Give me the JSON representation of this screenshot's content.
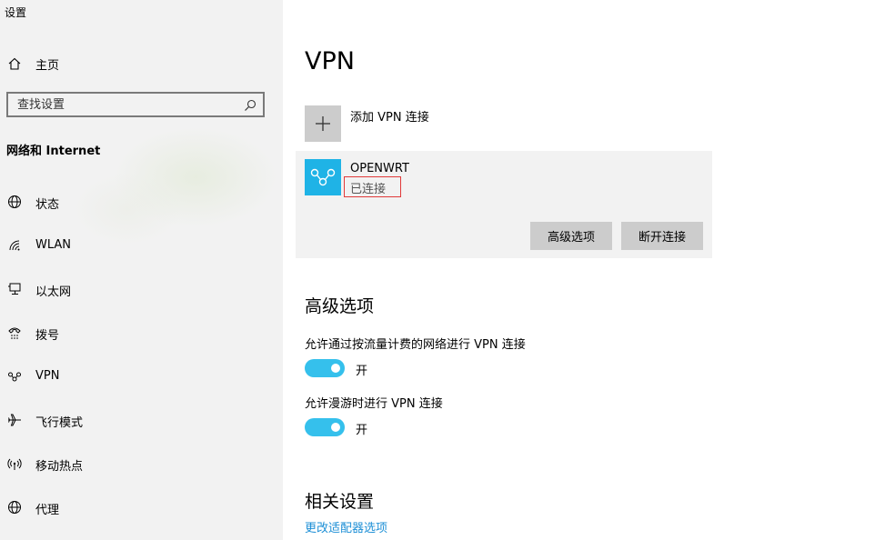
{
  "window": {
    "title": "设置"
  },
  "sidebar": {
    "home_label": "主页",
    "search_placeholder": "查找设置",
    "section_title": "网络和 Internet",
    "items": [
      {
        "label": "状态",
        "icon": "globe-icon"
      },
      {
        "label": "WLAN",
        "icon": "wifi-icon"
      },
      {
        "label": "以太网",
        "icon": "ethernet-icon"
      },
      {
        "label": "拨号",
        "icon": "dialup-icon"
      },
      {
        "label": "VPN",
        "icon": "vpn-icon"
      },
      {
        "label": "飞行模式",
        "icon": "airplane-icon"
      },
      {
        "label": "移动热点",
        "icon": "hotspot-icon"
      },
      {
        "label": "代理",
        "icon": "globe-icon"
      }
    ]
  },
  "main": {
    "title": "VPN",
    "add_vpn_label": "添加 VPN 连接",
    "connection": {
      "name": "OPENWRT",
      "status": "已连接",
      "advanced_button": "高级选项",
      "disconnect_button": "断开连接"
    },
    "advanced": {
      "heading": "高级选项",
      "metered_label": "允许通过按流量计费的网络进行 VPN 连接",
      "metered_state": "开",
      "roaming_label": "允许漫游时进行 VPN 连接",
      "roaming_state": "开"
    },
    "related": {
      "heading": "相关设置",
      "link": "更改适配器选项"
    }
  },
  "colors": {
    "accent": "#35c0ec",
    "vpn_tile": "#1fb3e6",
    "link": "#1d8fd6",
    "status_box": "#e03a3a"
  }
}
